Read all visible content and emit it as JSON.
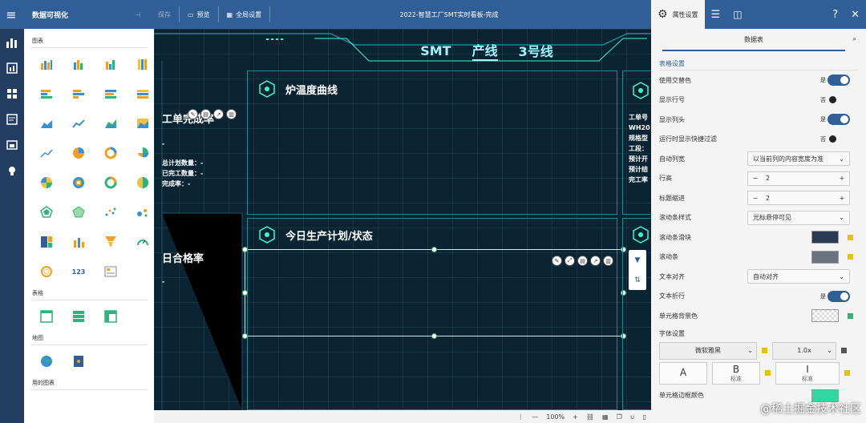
{
  "topbar": {
    "app_name": "数据可视化",
    "save": "保存",
    "preview": "预览",
    "global_settings": "全局设置",
    "doc_title": "2022-智慧工厂SMT实时看板-完成"
  },
  "palette": {
    "section_charts": "图表",
    "section_tables": "表格",
    "section_maps": "地图",
    "section_other": "用的图表"
  },
  "canvas": {
    "header_items": [
      "SMT",
      "产线",
      "3号线"
    ],
    "panel_furnace_title": "炉温度曲线",
    "panel_plan_title": "今日生产计划/状态",
    "left_kpi_title": "工单完成率",
    "left_kpi_dash": "-",
    "left_kpi_lines": [
      "总计划数量：-",
      "已完工数量：-",
      "完成率：-"
    ],
    "left_yield_title": "日合格率",
    "left_yield_dash": "-",
    "right_cut_lines": [
      "工单号",
      "WH20",
      "规格型",
      "工段：",
      "预计开",
      "预计结",
      "完工率"
    ],
    "zoom": "100%"
  },
  "right_panel": {
    "tab_props": "属性设置",
    "subtab_datatable": "数据表",
    "section_table": "表格设置",
    "rows": {
      "alt_color": {
        "label": "使用交替色",
        "state": "是"
      },
      "show_rownum": {
        "label": "显示行号",
        "state": "否"
      },
      "show_header": {
        "label": "显示列头",
        "state": "是"
      },
      "runtime_filter": {
        "label": "运行时显示快捷过滤",
        "state": "否"
      },
      "auto_width": {
        "label": "自动列宽",
        "value": "以当前列的内容宽度为准"
      },
      "row_height": {
        "label": "行高",
        "value": "2"
      },
      "header_indent": {
        "label": "标题缩进",
        "value": "2"
      },
      "scroll_style": {
        "label": "滚动条样式",
        "value": "光标悬停可见"
      },
      "scroll_slider": {
        "label": "滚动条滑块"
      },
      "scroll_bar": {
        "label": "滚动条"
      },
      "text_align": {
        "label": "文本对齐",
        "value": "自动对齐"
      },
      "text_wrap": {
        "label": "文本折行",
        "state": "是"
      },
      "cell_bg": {
        "label": "单元格背景色"
      }
    },
    "section_font": "字体设置",
    "font_family": "微软雅黑",
    "font_scale": "1.0x",
    "fmt_a": "A",
    "fmt_b": "B",
    "fmt_b_sub": "标准",
    "fmt_i": "I",
    "fmt_i_sub": "标准",
    "border_color": {
      "label": "单元格边框颜色"
    },
    "watermark": "@稀土掘金技术社区"
  },
  "colors": {
    "brand": "#2f5f96",
    "accent_cyan": "#9ef5ff",
    "swatch_slider": "#2a3a52",
    "swatch_bar": "#6b7380",
    "dot": "#e6c200",
    "border_swatch": "#30d7a0"
  }
}
